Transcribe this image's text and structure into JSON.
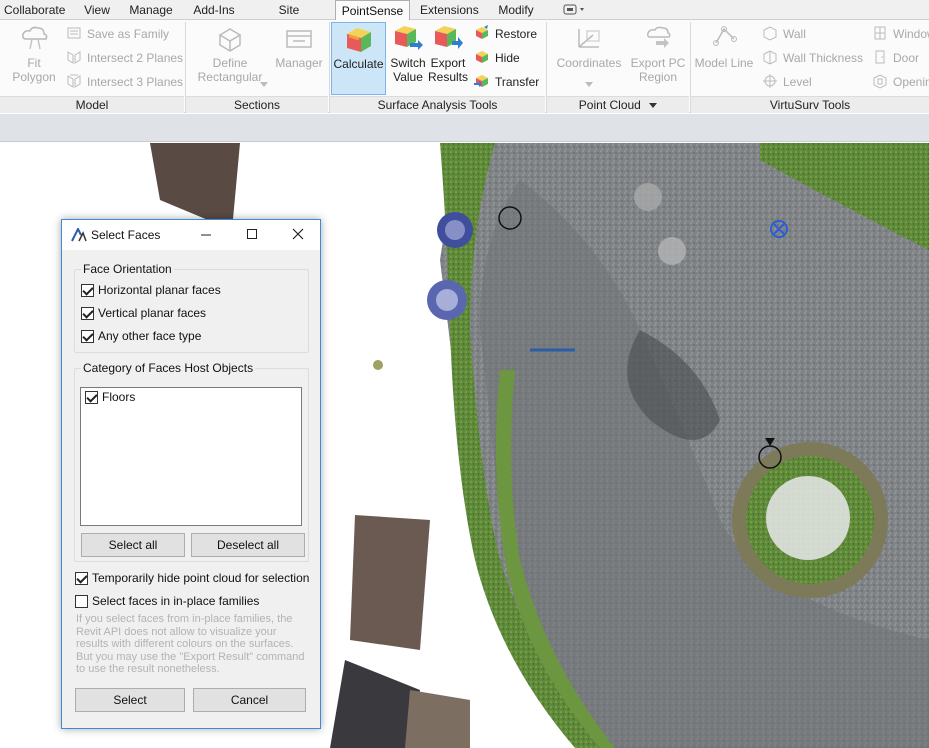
{
  "menubar": {
    "tabs": [
      {
        "label": "Collaborate",
        "active": false
      },
      {
        "label": "View",
        "active": false
      },
      {
        "label": "Manage",
        "active": false
      },
      {
        "label": "Add-Ins",
        "active": false
      },
      {
        "label": "Site Designer",
        "active": false
      },
      {
        "label": "PointSense",
        "active": true
      },
      {
        "label": "Extensions",
        "active": false
      },
      {
        "label": "Modify",
        "active": false
      }
    ]
  },
  "ribbon": {
    "model": {
      "title": "Model",
      "fit_polygon": {
        "line1": "Fit",
        "line2": "Polygon"
      },
      "save_as_family": "Save as Family",
      "intersect_2": "Intersect 2 Planes",
      "intersect_3": "Intersect 3 Planes"
    },
    "sections": {
      "title": "Sections",
      "define_rectangular": {
        "line1": "Define",
        "line2": "Rectangular"
      },
      "manager": "Manager"
    },
    "surface": {
      "title": "Surface Analysis Tools",
      "calculate": "Calculate",
      "switch_value": {
        "line1": "Switch",
        "line2": "Value"
      },
      "export_results": {
        "line1": "Export",
        "line2": "Results"
      },
      "restore": "Restore",
      "hide": "Hide",
      "transfer": "Transfer"
    },
    "point_cloud": {
      "title": "Point Cloud",
      "coordinates": "Coordinates",
      "export_pc_region": {
        "line1": "Export PC",
        "line2": "Region"
      }
    },
    "virtusurv": {
      "title": "VirtuSurv Tools",
      "model_line": "Model Line",
      "wall": "Wall",
      "wall_thickness": "Wall Thickness",
      "level": "Level",
      "window": "Window",
      "door": "Door",
      "opening": "Openin"
    }
  },
  "dialog": {
    "title": "Select Faces",
    "face_orientation": {
      "label": "Face Orientation",
      "horizontal": {
        "label": "Horizontal planar faces",
        "checked": true
      },
      "vertical": {
        "label": "Vertical planar faces",
        "checked": true
      },
      "other": {
        "label": "Any other face type",
        "checked": true
      }
    },
    "category": {
      "label": "Category of Faces Host Objects",
      "items": [
        {
          "label": "Floors",
          "checked": true
        }
      ],
      "select_all": "Select all",
      "deselect_all": "Deselect all"
    },
    "hide_point_cloud": {
      "label": "Temporarily hide point cloud for selection",
      "checked": true
    },
    "inplace": {
      "label": "Select faces in in-place families",
      "checked": false
    },
    "hint": "If you select faces from in-place families, the Revit API does not allow to visualize your results with different colours on the surfaces. But you may use the \"Export Result\" command to use the result nonetheless.",
    "select_button": "Select",
    "cancel_button": "Cancel"
  },
  "colors": {
    "accent": "#3c8ad8",
    "active_button": "#cde6f7",
    "road": "#8b8d8f",
    "grass": "#5f8a3a"
  }
}
